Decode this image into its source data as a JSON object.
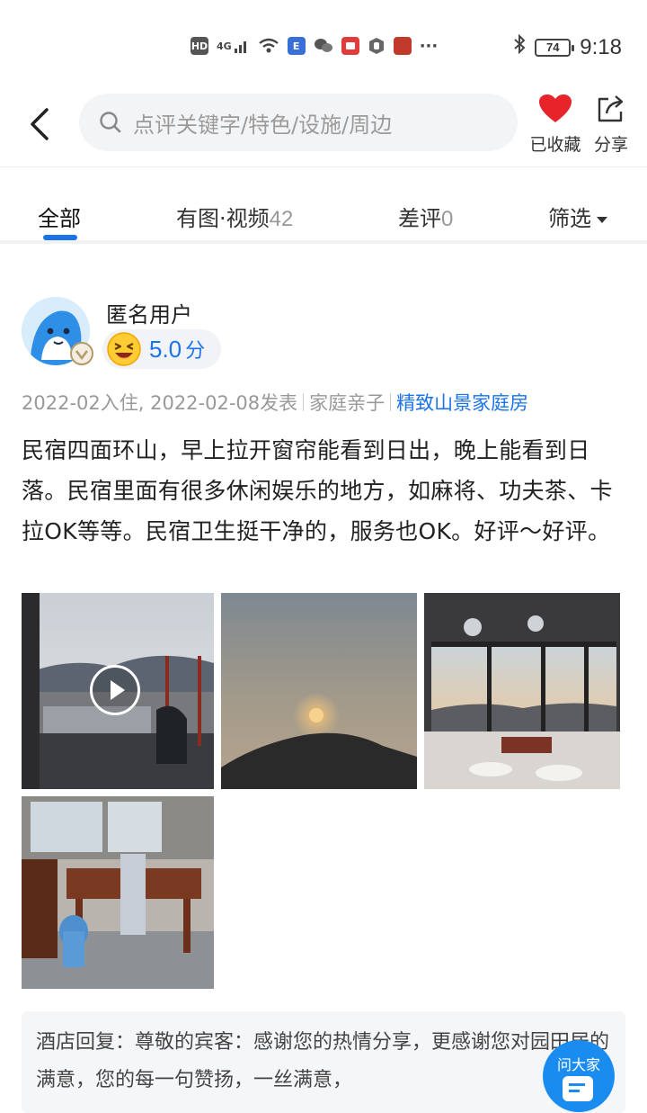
{
  "status_bar": {
    "left_icons": [
      "hd-icon",
      "4g-signal-icon",
      "wifi-icon",
      "app-e-icon",
      "wechat-icon",
      "app-red-icon",
      "app-hand-icon",
      "app-game-icon",
      "more-dots-icon"
    ],
    "hd": "HD",
    "net": "4G",
    "battery": "74",
    "time": "9:18",
    "more": "···"
  },
  "header": {
    "search_placeholder": "点评关键字/特色/设施/周边",
    "favorite_label": "已收藏",
    "share_label": "分享",
    "favorite_color": "#e8242b"
  },
  "tabs": [
    {
      "label": "全部",
      "count": ""
    },
    {
      "label": "有图·视频",
      "count": "42"
    },
    {
      "label": "差评",
      "count": "0"
    },
    {
      "label": "筛选",
      "count": ""
    }
  ],
  "review": {
    "username": "匿名用户",
    "rating": "5.0",
    "rating_unit": "分",
    "checkin": "2022-02入住, 2022-02-08发表",
    "trip_type": "家庭亲子",
    "room_type": "精致山景家庭房",
    "text": "民宿四面环山，早上拉开窗帘能看到日出，晚上能看到日落。民宿里面有很多休闲娱乐的地方，如麻将、功夫茶、卡拉OK等等。民宿卫生挺干净的，服务也OK。好评～好评。",
    "photos": [
      {
        "name": "photo-balcony-video",
        "is_video": true
      },
      {
        "name": "photo-sunset",
        "is_video": false
      },
      {
        "name": "photo-sunroom",
        "is_video": false
      },
      {
        "name": "photo-tea-room",
        "is_video": false
      }
    ]
  },
  "reply": {
    "text": "酒店回复：尊敬的宾客：感谢您的热情分享，更感谢您对园田居的满意，您的每一句赞扬，一丝满意，"
  },
  "ask_button": {
    "label": "问大家"
  },
  "colors": {
    "accent": "#1a73e8",
    "ask_blue": "#1a8cf0"
  }
}
